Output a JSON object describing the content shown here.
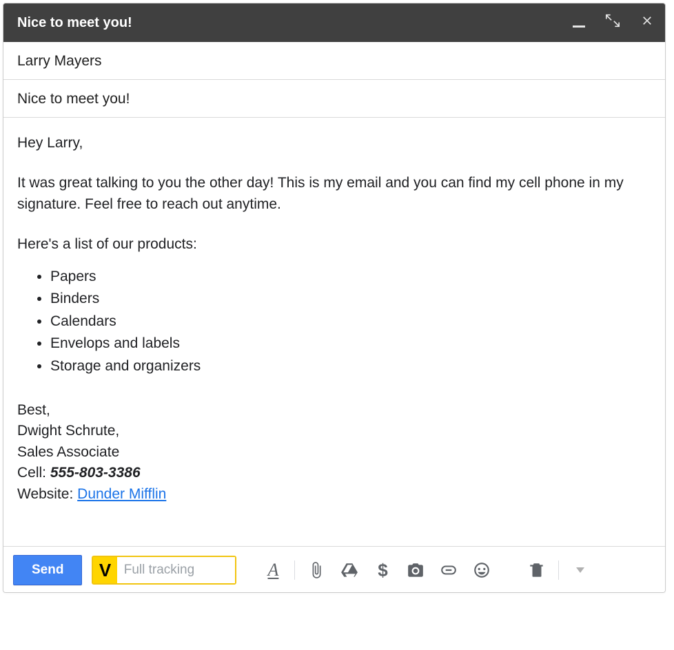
{
  "window": {
    "title": "Nice to meet you!"
  },
  "fields": {
    "to": "Larry Mayers",
    "subject": "Nice to meet you!"
  },
  "body": {
    "greeting": "Hey Larry,",
    "para1": "It was great talking to you the other day! This is my email and you can find my cell phone in my signature. Feel free to reach out anytime.",
    "listIntro": "Here's a list of our products:",
    "products": [
      "Papers",
      "Binders",
      "Calendars",
      "Envelops and labels",
      "Storage and organizers"
    ],
    "signature": {
      "closing": "Best,",
      "name": "Dwight Schrute,",
      "role": "Sales Associate",
      "cell_label": "Cell: ",
      "cell_number": "555-803-3386",
      "website_label": "Website: ",
      "website_text": "Dunder Mifflin"
    }
  },
  "toolbar": {
    "send_label": "Send",
    "track_badge": "V",
    "track_placeholder": "Full tracking"
  }
}
